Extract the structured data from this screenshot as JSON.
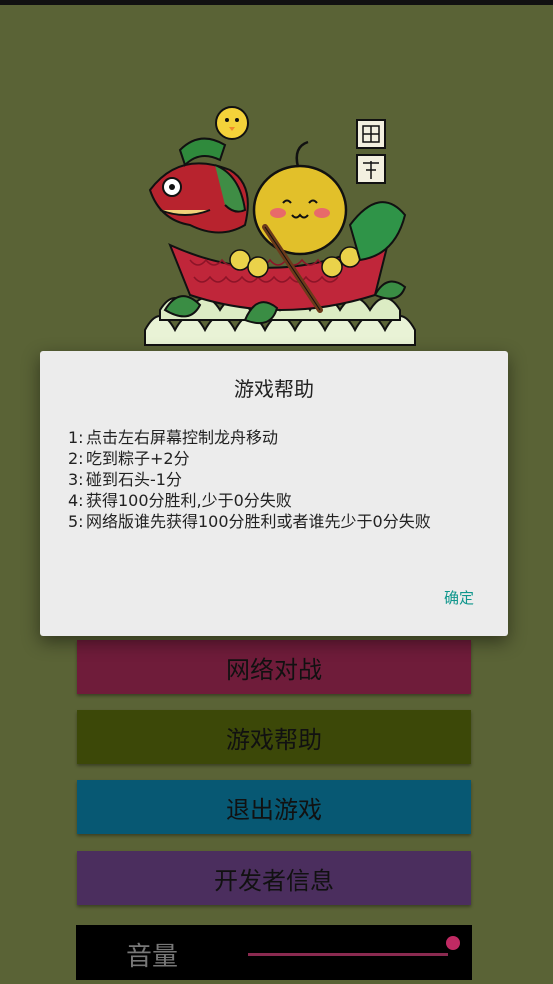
{
  "menu": {
    "network_battle": "网络对战",
    "game_help": "游戏帮助",
    "exit_game": "退出游戏",
    "developer_info": "开发者信息"
  },
  "volume": {
    "label": "音量",
    "level": 1.0
  },
  "illustration": {
    "seal_text": "端午"
  },
  "dialog": {
    "title": "游戏帮助",
    "items": [
      {
        "num": "1:",
        "text": "点击左右屏幕控制龙舟移动"
      },
      {
        "num": "2:",
        "text": "吃到粽子+2分"
      },
      {
        "num": "3:",
        "text": "碰到石头-1分"
      },
      {
        "num": "4:",
        "text": "获得100分胜利,少于0分失败"
      },
      {
        "num": "5:",
        "text": "网络版谁先获得100分胜利或者谁先少于0分失败"
      }
    ],
    "confirm_label": "确定"
  },
  "colors": {
    "background": "#5a6336",
    "network_button": "#6f1c3a",
    "help_button": "#3c4808",
    "exit_button": "#075873",
    "developer_button": "#4b2e5e",
    "accent": "#0f968c"
  }
}
